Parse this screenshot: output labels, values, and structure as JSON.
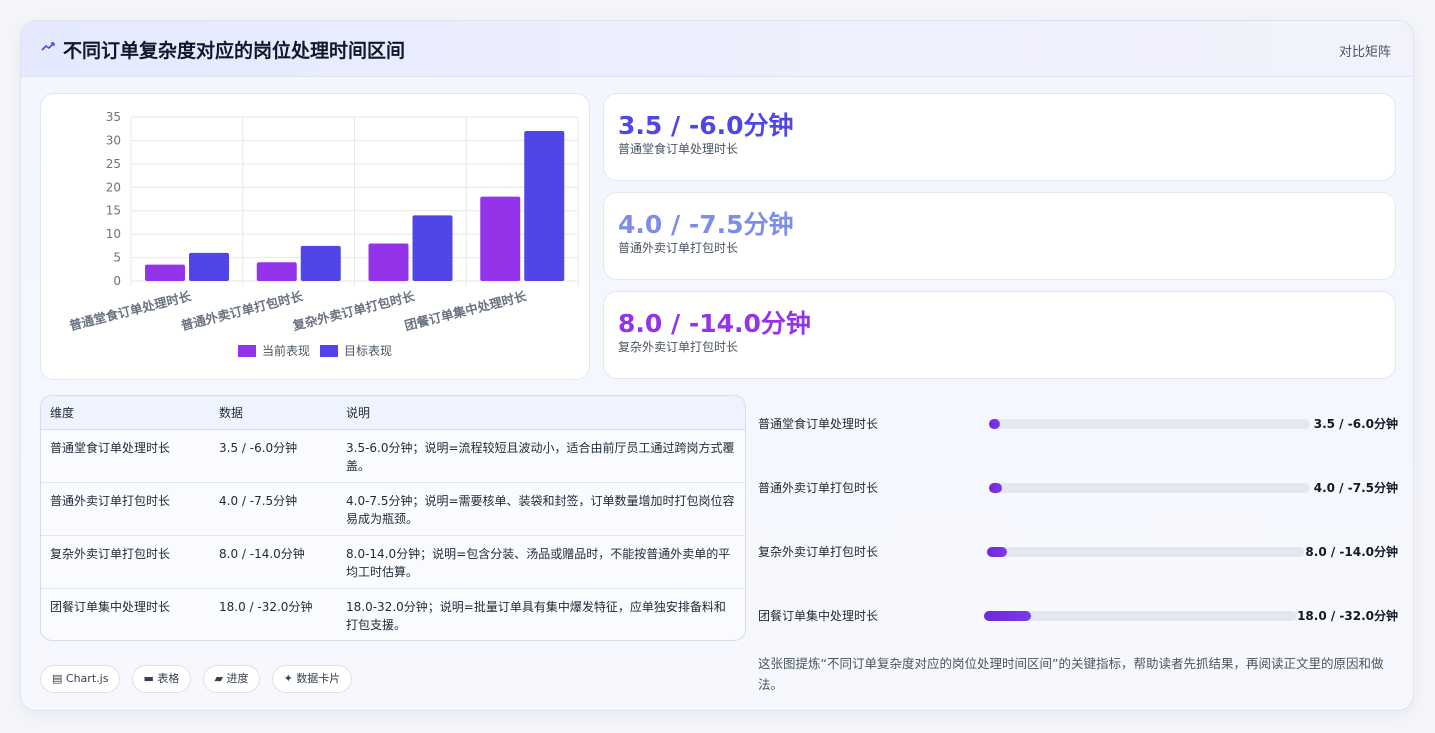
{
  "header": {
    "icon": "trend-icon",
    "title": "不同订单复杂度对应的岗位处理时间区间",
    "tag": "对比矩阵"
  },
  "chart_data": {
    "type": "bar",
    "categories": [
      "普通堂食订单处理时长",
      "普通外卖订单打包时长",
      "复杂外卖订单打包时长",
      "团餐订单集中处理时长"
    ],
    "series": [
      {
        "name": "当前表现",
        "values": [
          3.5,
          4.0,
          8.0,
          18.0
        ],
        "color": "#9333ea"
      },
      {
        "name": "目标表现",
        "values": [
          6.0,
          7.5,
          14.0,
          32.0
        ],
        "color": "#4f46e5"
      }
    ],
    "yticks": [
      "0",
      "5",
      "10",
      "15",
      "20",
      "25",
      "30",
      "35"
    ],
    "ylim": [
      0,
      35
    ],
    "grid": true,
    "legend": "bottom"
  },
  "stats": [
    {
      "value": "3.5 / -6.0分钟",
      "label": "普通堂食订单处理时长",
      "color": "#4f46e5"
    },
    {
      "value": "4.0 / -7.5分钟",
      "label": "普通外卖订单打包时长",
      "color": "#7c8ee8"
    },
    {
      "value": "8.0 / -14.0分钟",
      "label": "复杂外卖订单打包时长",
      "color": "#9333ea"
    }
  ],
  "table": {
    "headers": [
      "维度",
      "数据",
      "说明"
    ],
    "rows": [
      [
        "普通堂食订单处理时长",
        "3.5 / -6.0分钟",
        "3.5-6.0分钟；说明=流程较短且波动小，适合由前厅员工通过跨岗方式覆盖。"
      ],
      [
        "普通外卖订单打包时长",
        "4.0 / -7.5分钟",
        "4.0-7.5分钟；说明=需要核单、装袋和封签，订单数量增加时打包岗位容易成为瓶颈。"
      ],
      [
        "复杂外卖订单打包时长",
        "8.0 / -14.0分钟",
        "8.0-14.0分钟；说明=包含分装、汤品或赠品时，不能按普通外卖单的平均工时估算。"
      ],
      [
        "团餐订单集中处理时长",
        "18.0 / -32.0分钟",
        "18.0-32.0分钟；说明=批量订单具有集中爆发特征，应单独安排备料和打包支援。"
      ]
    ]
  },
  "progress": [
    {
      "label": "普通堂食订单处理时长",
      "value": "3.5 / -6.0分钟",
      "fill": 0.035
    },
    {
      "label": "普通外卖订单打包时长",
      "value": "4.0 / -7.5分钟",
      "fill": 0.04
    },
    {
      "label": "复杂外卖订单打包时长",
      "value": "8.0 / -14.0分钟",
      "fill": 0.063
    },
    {
      "label": "团餐订单集中处理时长",
      "value": "18.0 / -32.0分钟",
      "fill": 0.15
    }
  ],
  "note": "这张图提炼“不同订单复杂度对应的岗位处理时间区间”的关键指标，帮助读者先抓结果，再阅读正文里的原因和做法。",
  "chips": [
    {
      "icon": "chart-icon",
      "glyph": "▤",
      "label": "Chart.js"
    },
    {
      "icon": "table-icon",
      "glyph": "▬",
      "label": "表格"
    },
    {
      "icon": "folder-icon",
      "glyph": "▰",
      "label": "进度"
    },
    {
      "icon": "sparkle-icon",
      "glyph": "✦",
      "label": "数据卡片"
    }
  ]
}
